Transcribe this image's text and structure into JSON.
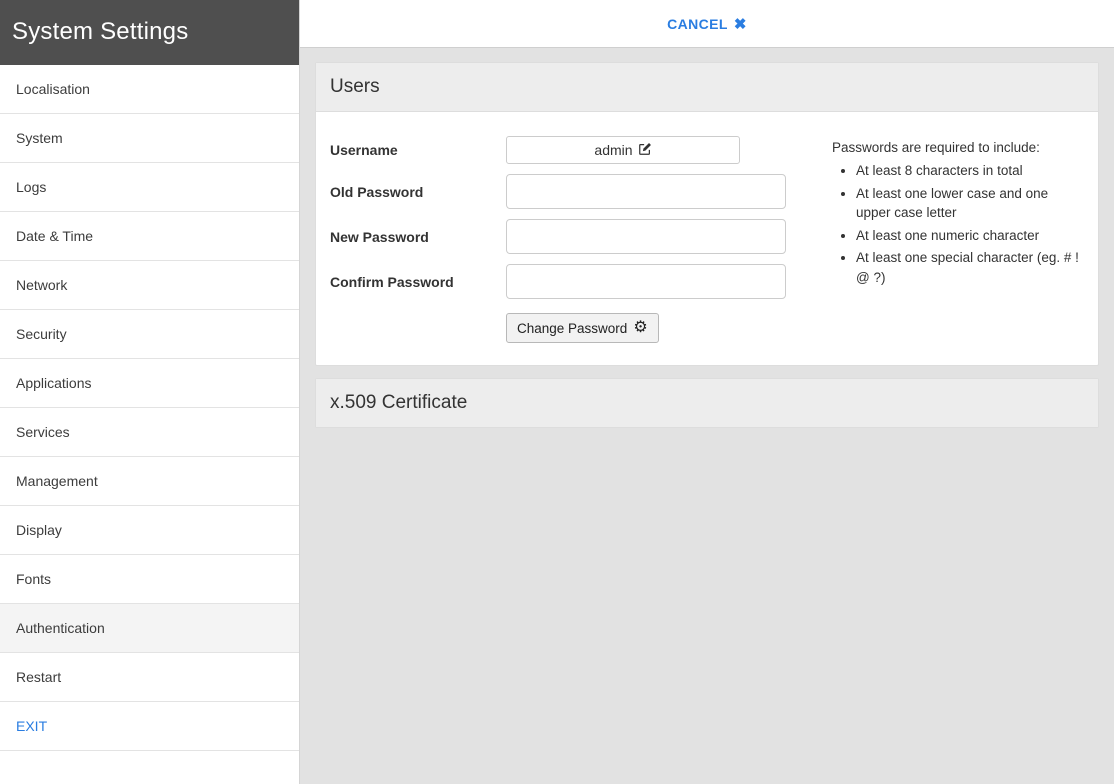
{
  "sidebar": {
    "title": "System Settings",
    "items": [
      {
        "label": "Localisation"
      },
      {
        "label": "System"
      },
      {
        "label": "Logs"
      },
      {
        "label": "Date & Time"
      },
      {
        "label": "Network"
      },
      {
        "label": "Security"
      },
      {
        "label": "Applications"
      },
      {
        "label": "Services"
      },
      {
        "label": "Management"
      },
      {
        "label": "Display"
      },
      {
        "label": "Fonts"
      },
      {
        "label": "Authentication"
      },
      {
        "label": "Restart"
      },
      {
        "label": "EXIT"
      }
    ]
  },
  "topbar": {
    "cancel_label": "CANCEL"
  },
  "users_panel": {
    "title": "Users",
    "form": {
      "username_label": "Username",
      "username_value": "admin",
      "old_password_label": "Old Password",
      "new_password_label": "New Password",
      "confirm_password_label": "Confirm Password",
      "change_password_label": "Change Password"
    },
    "requirements": {
      "intro": "Passwords are required to include:",
      "items": [
        "At least 8 characters in total",
        "At least one lower case and one upper case letter",
        "At least one numeric character",
        "At least one special character (eg. # ! @ ?)"
      ]
    }
  },
  "certificate_panel": {
    "title": "x.509 Certificate"
  },
  "colors": {
    "accent_blue": "#2a7de1",
    "sidebar_header_bg": "#4f4f4f",
    "panel_header_bg": "#ededed"
  }
}
